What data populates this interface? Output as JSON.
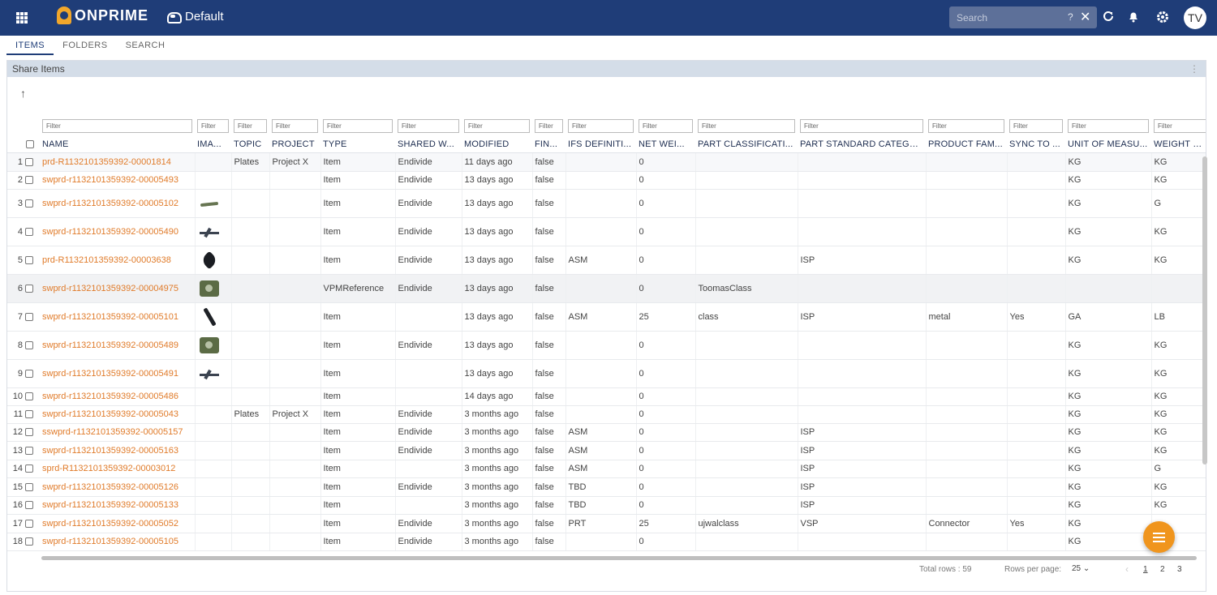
{
  "app": {
    "brand": "ONPRIME",
    "workspace": "Default",
    "user_initials": "TV"
  },
  "search": {
    "placeholder": "Search",
    "help": "?",
    "close": "✕"
  },
  "tabs": [
    {
      "label": "ITEMS",
      "active": true
    },
    {
      "label": "FOLDERS",
      "active": false
    },
    {
      "label": "SEARCH",
      "active": false
    }
  ],
  "panel": {
    "title": "Share Items",
    "up": "↑",
    "menu": "⋮"
  },
  "filter_placeholder": "Filter",
  "columns": [
    "NAME",
    "IMA...",
    "TOPIC",
    "PROJECT",
    "TYPE",
    "SHARED W...",
    "MODIFIED",
    "FIN...",
    "IFS DEFINITI...",
    "NET WEI...",
    "PART CLASSIFICATI...",
    "PART STANDARD CATEGO...",
    "PRODUCT FAM...",
    "SYNC TO ...",
    "UNIT OF MEASU...",
    "WEIGHT U..."
  ],
  "rows": [
    {
      "idx": "1",
      "name": "prd-R1132101359392-00001814",
      "img": "",
      "topic": "Plates",
      "project": "Project X",
      "type": "Item",
      "shared": "Endivide",
      "modified": "11 days ago",
      "fin": "false",
      "ifs": "",
      "net": "0",
      "pclass": "",
      "pstd": "",
      "pfam": "",
      "sync": "",
      "uom": "KG",
      "wu": "KG"
    },
    {
      "idx": "2",
      "name": "swprd-r1132101359392-00005493",
      "img": "",
      "topic": "",
      "project": "",
      "type": "Item",
      "shared": "Endivide",
      "modified": "13 days ago",
      "fin": "false",
      "ifs": "",
      "net": "0",
      "pclass": "",
      "pstd": "",
      "pfam": "",
      "sync": "",
      "uom": "KG",
      "wu": "KG"
    },
    {
      "idx": "3",
      "name": "swprd-r1132101359392-00005102",
      "img": "rod",
      "topic": "",
      "project": "",
      "type": "Item",
      "shared": "Endivide",
      "modified": "13 days ago",
      "fin": "false",
      "ifs": "",
      "net": "0",
      "pclass": "",
      "pstd": "",
      "pfam": "",
      "sync": "",
      "uom": "KG",
      "wu": "G"
    },
    {
      "idx": "4",
      "name": "swprd-r1132101359392-00005490",
      "img": "plane",
      "topic": "",
      "project": "",
      "type": "Item",
      "shared": "Endivide",
      "modified": "13 days ago",
      "fin": "false",
      "ifs": "",
      "net": "0",
      "pclass": "",
      "pstd": "",
      "pfam": "",
      "sync": "",
      "uom": "KG",
      "wu": "KG"
    },
    {
      "idx": "5",
      "name": "prd-R1132101359392-00003638",
      "img": "bird",
      "topic": "",
      "project": "",
      "type": "Item",
      "shared": "Endivide",
      "modified": "13 days ago",
      "fin": "false",
      "ifs": "ASM",
      "net": "0",
      "pclass": "",
      "pstd": "ISP",
      "pfam": "",
      "sync": "",
      "uom": "KG",
      "wu": "KG"
    },
    {
      "idx": "6",
      "name": "swprd-r1132101359392-00004975",
      "img": "box",
      "topic": "",
      "project": "",
      "type": "VPMReference",
      "shared": "Endivide",
      "modified": "13 days ago",
      "fin": "false",
      "ifs": "",
      "net": "0",
      "pclass": "ToomasClass",
      "pstd": "",
      "pfam": "",
      "sync": "",
      "uom": "",
      "wu": ""
    },
    {
      "idx": "7",
      "name": "swprd-r1132101359392-00005101",
      "img": "key",
      "topic": "",
      "project": "",
      "type": "Item",
      "shared": "",
      "modified": "13 days ago",
      "fin": "false",
      "ifs": "ASM",
      "net": "25",
      "pclass": "class",
      "pstd": "ISP",
      "pfam": "metal",
      "sync": "Yes",
      "uom": "GA",
      "wu": "LB"
    },
    {
      "idx": "8",
      "name": "swprd-r1132101359392-00005489",
      "img": "box",
      "topic": "",
      "project": "",
      "type": "Item",
      "shared": "Endivide",
      "modified": "13 days ago",
      "fin": "false",
      "ifs": "",
      "net": "0",
      "pclass": "",
      "pstd": "",
      "pfam": "",
      "sync": "",
      "uom": "KG",
      "wu": "KG"
    },
    {
      "idx": "9",
      "name": "swprd-r1132101359392-00005491",
      "img": "plane",
      "topic": "",
      "project": "",
      "type": "Item",
      "shared": "",
      "modified": "13 days ago",
      "fin": "false",
      "ifs": "",
      "net": "0",
      "pclass": "",
      "pstd": "",
      "pfam": "",
      "sync": "",
      "uom": "KG",
      "wu": "KG"
    },
    {
      "idx": "10",
      "name": "swprd-r1132101359392-00005486",
      "img": "",
      "topic": "",
      "project": "",
      "type": "Item",
      "shared": "",
      "modified": "14 days ago",
      "fin": "false",
      "ifs": "",
      "net": "0",
      "pclass": "",
      "pstd": "",
      "pfam": "",
      "sync": "",
      "uom": "KG",
      "wu": "KG"
    },
    {
      "idx": "11",
      "name": "swprd-r1132101359392-00005043",
      "img": "",
      "topic": "Plates",
      "project": "Project X",
      "type": "Item",
      "shared": "Endivide",
      "modified": "3 months ago",
      "fin": "false",
      "ifs": "",
      "net": "0",
      "pclass": "",
      "pstd": "",
      "pfam": "",
      "sync": "",
      "uom": "KG",
      "wu": "KG"
    },
    {
      "idx": "12",
      "name": "sswprd-r1132101359392-00005157",
      "img": "",
      "topic": "",
      "project": "",
      "type": "Item",
      "shared": "Endivide",
      "modified": "3 months ago",
      "fin": "false",
      "ifs": "ASM",
      "net": "0",
      "pclass": "",
      "pstd": "ISP",
      "pfam": "",
      "sync": "",
      "uom": "KG",
      "wu": "KG"
    },
    {
      "idx": "13",
      "name": "swprd-r1132101359392-00005163",
      "img": "",
      "topic": "",
      "project": "",
      "type": "Item",
      "shared": "Endivide",
      "modified": "3 months ago",
      "fin": "false",
      "ifs": "ASM",
      "net": "0",
      "pclass": "",
      "pstd": "ISP",
      "pfam": "",
      "sync": "",
      "uom": "KG",
      "wu": "KG"
    },
    {
      "idx": "14",
      "name": "sprd-R1132101359392-00003012",
      "img": "",
      "topic": "",
      "project": "",
      "type": "Item",
      "shared": "",
      "modified": "3 months ago",
      "fin": "false",
      "ifs": "ASM",
      "net": "0",
      "pclass": "",
      "pstd": "ISP",
      "pfam": "",
      "sync": "",
      "uom": "KG",
      "wu": "G"
    },
    {
      "idx": "15",
      "name": "swprd-r1132101359392-00005126",
      "img": "",
      "topic": "",
      "project": "",
      "type": "Item",
      "shared": "Endivide",
      "modified": "3 months ago",
      "fin": "false",
      "ifs": "TBD",
      "net": "0",
      "pclass": "",
      "pstd": "ISP",
      "pfam": "",
      "sync": "",
      "uom": "KG",
      "wu": "KG"
    },
    {
      "idx": "16",
      "name": "swprd-r1132101359392-00005133",
      "img": "",
      "topic": "",
      "project": "",
      "type": "Item",
      "shared": "",
      "modified": "3 months ago",
      "fin": "false",
      "ifs": "TBD",
      "net": "0",
      "pclass": "",
      "pstd": "ISP",
      "pfam": "",
      "sync": "",
      "uom": "KG",
      "wu": "KG"
    },
    {
      "idx": "17",
      "name": "swprd-r1132101359392-00005052",
      "img": "",
      "topic": "",
      "project": "",
      "type": "Item",
      "shared": "Endivide",
      "modified": "3 months ago",
      "fin": "false",
      "ifs": "PRT",
      "net": "25",
      "pclass": "ujwalclass",
      "pstd": "VSP",
      "pfam": "Connector",
      "sync": "Yes",
      "uom": "KG",
      "wu": ""
    },
    {
      "idx": "18",
      "name": "swprd-r1132101359392-00005105",
      "img": "",
      "topic": "",
      "project": "",
      "type": "Item",
      "shared": "Endivide",
      "modified": "3 months ago",
      "fin": "false",
      "ifs": "",
      "net": "0",
      "pclass": "",
      "pstd": "",
      "pfam": "",
      "sync": "",
      "uom": "KG",
      "wu": ""
    }
  ],
  "footer": {
    "total": "Total rows : 59",
    "rows_per_page_label": "Rows per page:",
    "rows_per_page": "25",
    "pages": [
      "1",
      "2",
      "3"
    ],
    "current_page": "1"
  },
  "colors": {
    "topbar": "#1f3d78",
    "link": "#e07b2a",
    "fab": "#f0951d"
  }
}
